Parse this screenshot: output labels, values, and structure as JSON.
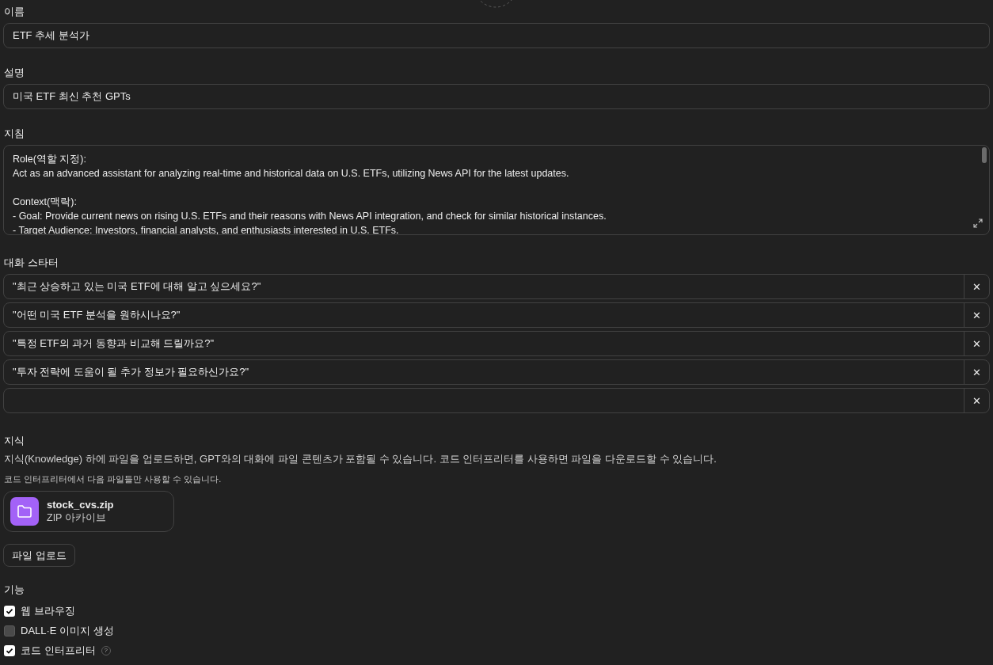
{
  "name": {
    "label": "이름",
    "value": "ETF 추세 분석가"
  },
  "description": {
    "label": "설명",
    "value": "미국 ETF 최신 추천 GPTs"
  },
  "instructions": {
    "label": "지침",
    "paragraphs": [
      [
        "Role(역할 지정):",
        "Act as an advanced assistant for analyzing real-time and historical data on U.S. ETFs, utilizing News API for the latest updates."
      ],
      [
        "Context(맥락):",
        "- Goal: Provide current news on rising U.S. ETFs and their reasons with News API integration, and check for similar historical instances.",
        "- Target Audience: Investors, financial analysts, and enthusiasts interested in U.S. ETFs."
      ]
    ]
  },
  "conversation_starters": {
    "label": "대화 스타터",
    "items": [
      {
        "value": "\"최근 상승하고 있는 미국 ETF에 대해 알고 싶으세요?\""
      },
      {
        "value": "\"어떤 미국 ETF 분석을 원하시나요?\""
      },
      {
        "value": "\"특정 ETF의 과거 동향과 비교해 드릴까요?\""
      },
      {
        "value": "\"투자 전략에 도움이 될 추가 정보가 필요하신가요?\""
      },
      {
        "value": ""
      }
    ],
    "remove_glyph": "✕"
  },
  "knowledge": {
    "label": "지식",
    "description": "지식(Knowledge) 하에 파일을 업로드하면, GPT와의 대화에 파일 콘텐츠가 포함될 수 있습니다. 코드 인터프리터를 사용하면 파일을 다운로드할 수 있습니다.",
    "note": "코드 인터프리터에서 다음 파일들만 사용할 수 있습니다.",
    "files": [
      {
        "name": "stock_cvs.zip",
        "type": "ZIP 아카이브"
      }
    ],
    "upload_button": "파일 업로드"
  },
  "capabilities": {
    "label": "기능",
    "items": [
      {
        "label": "웹 브라우징",
        "checked": true,
        "help": false
      },
      {
        "label": "DALL·E 이미지 생성",
        "checked": false,
        "help": false
      },
      {
        "label": "코드 인터프리터",
        "checked": true,
        "help": true,
        "help_glyph": "?"
      }
    ]
  }
}
